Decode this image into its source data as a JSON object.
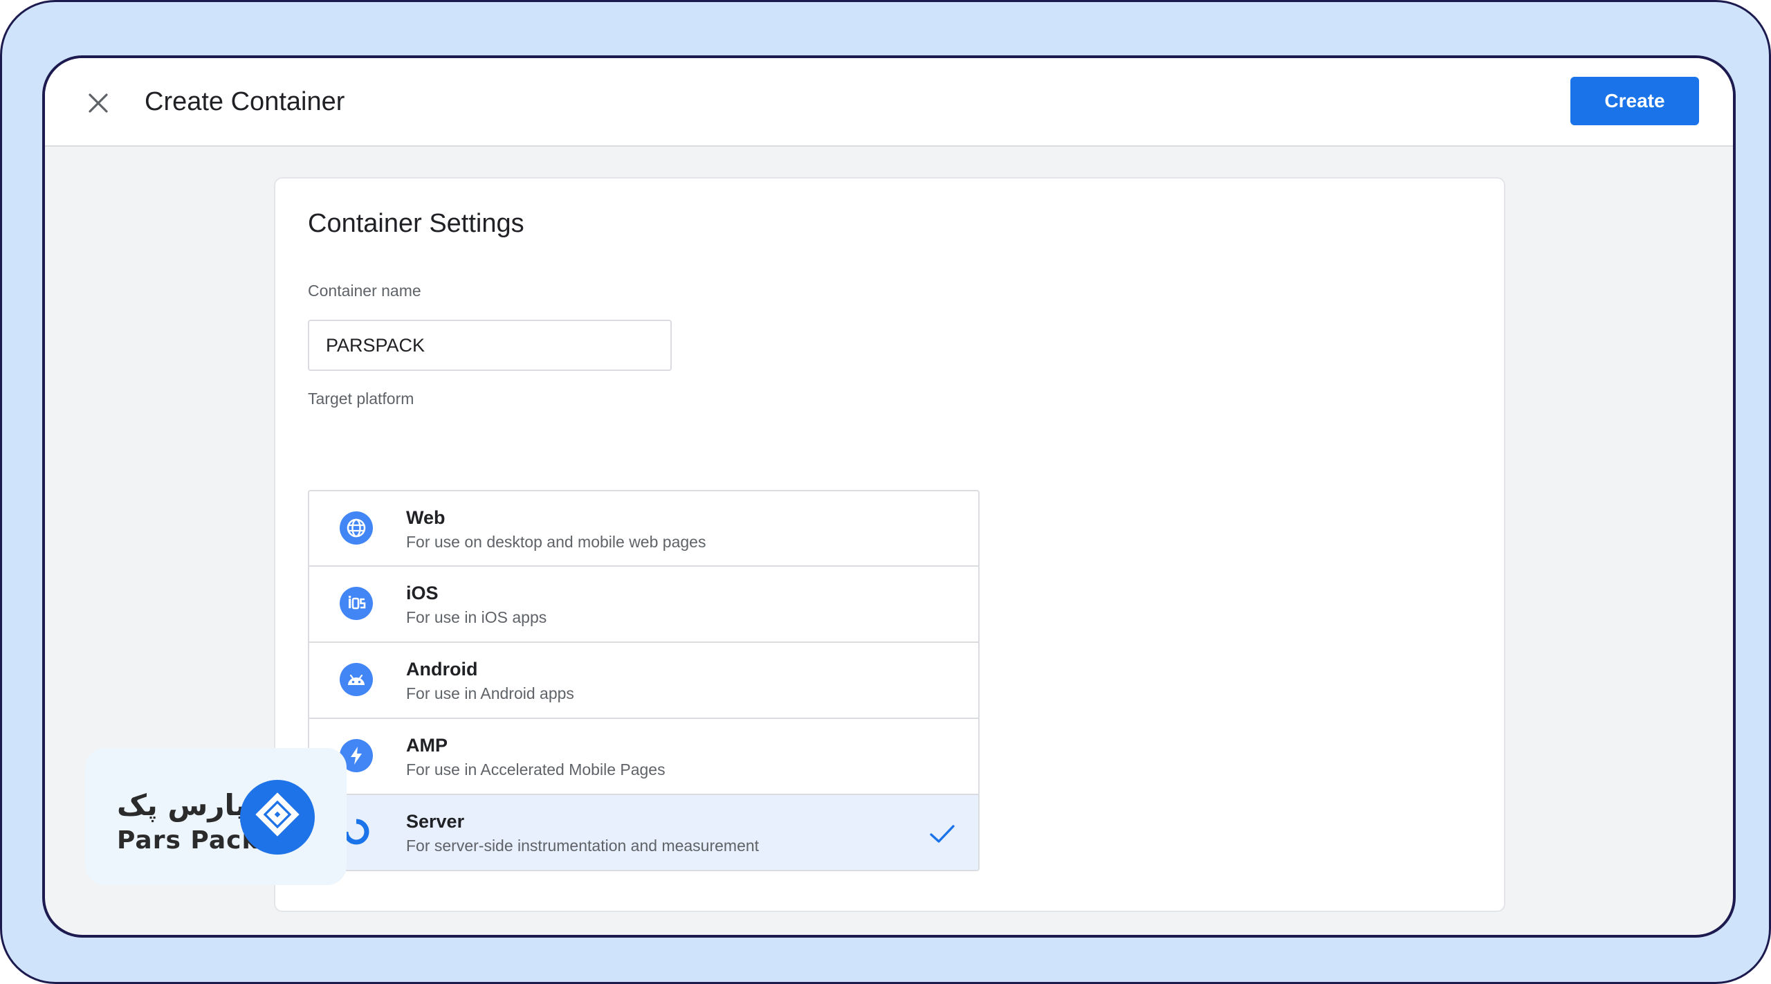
{
  "dialog": {
    "title": "Create Container",
    "create_label": "Create",
    "close_icon": "close-icon"
  },
  "settings": {
    "heading": "Container Settings",
    "name_label": "Container name",
    "name_value": "PARSPACK",
    "platform_label": "Target platform",
    "platforms": [
      {
        "name": "Web",
        "desc": "For use on desktop and mobile web pages",
        "icon": "globe-icon",
        "selected": false
      },
      {
        "name": "iOS",
        "desc": "For use in iOS apps",
        "icon": "ios-icon",
        "selected": false
      },
      {
        "name": "Android",
        "desc": "For use in Android apps",
        "icon": "android-icon",
        "selected": false
      },
      {
        "name": "AMP",
        "desc": "For use in Accelerated Mobile Pages",
        "icon": "amp-bolt-icon",
        "selected": false
      },
      {
        "name": "Server",
        "desc": "For server-side instrumentation and measurement",
        "icon": "server-icon",
        "selected": true
      }
    ]
  },
  "watermark": {
    "name_fa": "پارس پک",
    "name_en": "Pars Pack"
  },
  "colors": {
    "accent": "#1a73e8",
    "frame_bg": "#cfe4fb",
    "frame_border": "#1c1a4e",
    "selected_row": "#e8f0fe",
    "platform_icon": "#4285f4"
  }
}
